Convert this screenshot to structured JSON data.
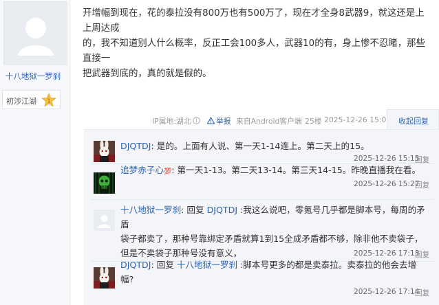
{
  "author": {
    "name": "十八地狱一罗刹",
    "level": "初涉江湖",
    "level_num": "1"
  },
  "post": {
    "lines": [
      "开增幅到现在，花的泰拉没有800万也有500万了，现在才全身8武器9，就这还是上上周达成",
      "的，我不知道别人什么概率，反正工会100多人，武器10的有，身上惨不忍睹，那些直接一",
      "把武器到底的，真的就是假的。"
    ],
    "meta": {
      "ip": "IP属地:湖北",
      "report": "举报",
      "source": "来自Android客户端",
      "floor": "25楼",
      "time": "2025-12-26 15:07",
      "toggle": "收起回复"
    }
  },
  "replies": [
    {
      "user": "DJQTDJ",
      "lines": [
        "是的。上面有人说、第一天1-14连上。第二天上的15。"
      ],
      "time": "2025-12-26 15:15",
      "reply_label": "回复"
    },
    {
      "user": "追梦赤子心",
      "badge": "💯",
      "lines": [
        "第一天1-13。第二天13-14。第三天14-15。昨晚直播我在看。"
      ],
      "time": "2025-12-26 15:27",
      "reply_label": "回复"
    },
    {
      "user": "十八地狱一罗刹",
      "prefix": "回复 ",
      "target": "DJQTDJ",
      "lines": [
        " :我这么说吧，零氪号几乎都是脚本号，每周的矛盾",
        "袋子都卖了，那种号靠绑定矛盾就算1到15全成矛盾都不够，除非他不卖袋子，",
        "但是不卖袋子那种号没有意义，"
      ],
      "time": "2025-12-26 17:13",
      "reply_label": "回复"
    },
    {
      "user": "DJQTDJ",
      "prefix": "回复 ",
      "target": "十八地狱一罗刹",
      "lines": [
        " :脚本号更多的都是卖泰拉。卖泰拉的他会去增",
        "幅?"
      ],
      "time": "2025-12-26 17:14",
      "reply_label": "回复"
    }
  ],
  "colors": {
    "link": "#2d64b3",
    "reply_bg": "#f3f5f8",
    "author_bg": "#f6f8fb"
  }
}
